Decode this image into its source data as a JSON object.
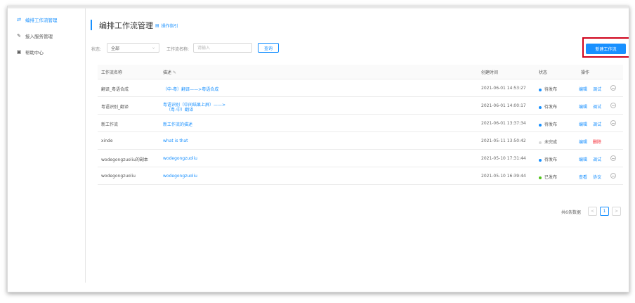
{
  "sidebar": {
    "items": [
      {
        "label": "编排工作流管理",
        "icon": "workflow-icon",
        "glyph": "⇄"
      },
      {
        "label": "接入服务管理",
        "icon": "edit-pen-icon",
        "glyph": "✎"
      },
      {
        "label": "帮助中心",
        "icon": "calendar-icon",
        "glyph": "▣"
      }
    ]
  },
  "header": {
    "title": "编排工作流管理",
    "guide_label": "操作指引",
    "guide_icon": "document-icon"
  },
  "filters": {
    "status_label": "状态:",
    "status_value": "全部",
    "name_label": "工作流名称:",
    "name_placeholder": "请输入",
    "query_label": "查询"
  },
  "new_button_label": "新建工作流",
  "table": {
    "headers": {
      "name": "工作流名称",
      "desc": "描述",
      "created": "创建时间",
      "status": "状态",
      "action": "操作"
    },
    "rows": [
      {
        "name": "翻译_粤语合成",
        "desc1": "（中-粤）翻译——>粤语合成",
        "desc2": "",
        "created": "2021-06-01 14:53:27",
        "status": "待发布",
        "status_color": "#1890ff",
        "a1": "编辑",
        "a2": "调试",
        "a2_color": "#1890ff",
        "more": true
      },
      {
        "name": "粤语识别_翻译",
        "desc1": "粤语识别（中间结果上屏）——>",
        "desc2": "（粤-中）翻译",
        "created": "2021-06-01 14:00:17",
        "status": "待发布",
        "status_color": "#1890ff",
        "a1": "编辑",
        "a2": "调试",
        "a2_color": "#1890ff",
        "more": true
      },
      {
        "name": "新工作流",
        "desc1": "新工作流的描述",
        "desc2": "",
        "created": "2021-06-01 13:37:34",
        "status": "待发布",
        "status_color": "#1890ff",
        "a1": "编辑",
        "a2": "调试",
        "a2_color": "#1890ff",
        "more": true
      },
      {
        "name": "xinde",
        "desc1": "what is that",
        "desc2": "",
        "created": "2021-05-11 13:50:42",
        "status": "未完成",
        "status_color": "#d9d9d9",
        "a1": "编辑",
        "a2": "删除",
        "a2_color": "#f5222d",
        "more": false
      },
      {
        "name": "wodegongzuoliu的副本",
        "desc1": "wodegongzuoliu",
        "desc2": "",
        "created": "2021-05-10 17:31:44",
        "status": "待发布",
        "status_color": "#1890ff",
        "a1": "编辑",
        "a2": "调试",
        "a2_color": "#1890ff",
        "more": true
      },
      {
        "name": "wodegongzuoliu",
        "desc1": "wodegongzuoliu",
        "desc2": "",
        "created": "2021-05-10 16:39:44",
        "status": "已发布",
        "status_color": "#52c41a",
        "a1": "查看",
        "a2": "协议",
        "a2_color": "#1890ff",
        "more": true
      }
    ]
  },
  "pagination": {
    "total_label": "共6条数据",
    "prev": "<",
    "current": "1",
    "next": ">"
  },
  "colors": {
    "accent": "#1890ff",
    "highlight_box": "#d0021b"
  }
}
